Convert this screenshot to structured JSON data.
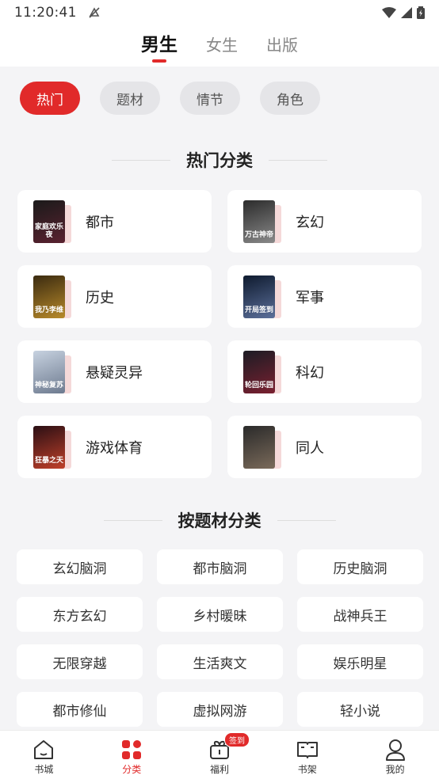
{
  "status_bar": {
    "time": "11:20:41"
  },
  "gender_tabs": [
    {
      "label": "男生",
      "active": true
    },
    {
      "label": "女生",
      "active": false
    },
    {
      "label": "出版",
      "active": false
    }
  ],
  "filter_chips": [
    {
      "label": "热门",
      "active": true
    },
    {
      "label": "题材",
      "active": false
    },
    {
      "label": "情节",
      "active": false
    },
    {
      "label": "角色",
      "active": false
    }
  ],
  "hot_section": {
    "title": "热门分类",
    "categories": [
      {
        "label": "都市",
        "cover_text": "家庭欢乐夜",
        "cover_colors": [
          "#1a1a1a",
          "#5a2230"
        ]
      },
      {
        "label": "玄幻",
        "cover_text": "万古神帝",
        "cover_colors": [
          "#2b2b2b",
          "#8a8a8a"
        ]
      },
      {
        "label": "历史",
        "cover_text": "我乃李维",
        "cover_colors": [
          "#3a2a10",
          "#b88a2a"
        ]
      },
      {
        "label": "军事",
        "cover_text": "开局签到",
        "cover_colors": [
          "#0e1a2e",
          "#5b6f9a"
        ]
      },
      {
        "label": "悬疑灵异",
        "cover_text": "神秘复苏",
        "cover_colors": [
          "#c7d2e0",
          "#6d7a8f"
        ]
      },
      {
        "label": "科幻",
        "cover_text": "轮回乐园",
        "cover_colors": [
          "#1c1c24",
          "#7a2030"
        ]
      },
      {
        "label": "游戏体育",
        "cover_text": "狂暴之天",
        "cover_colors": [
          "#2a0f14",
          "#c0402a"
        ]
      },
      {
        "label": "同人",
        "cover_text": "",
        "cover_colors": [
          "#2a2a2a",
          "#7a6a5a"
        ]
      }
    ]
  },
  "theme_section": {
    "title": "按题材分类",
    "tags": [
      "玄幻脑洞",
      "都市脑洞",
      "历史脑洞",
      "东方玄幻",
      "乡村暖昧",
      "战神兵王",
      "无限穿越",
      "生活爽文",
      "娱乐明星",
      "都市修仙",
      "虚拟网游",
      "轻小说"
    ]
  },
  "bottom_nav": [
    {
      "label": "书城",
      "icon": "home-icon",
      "active": false
    },
    {
      "label": "分类",
      "icon": "category-icon",
      "active": true
    },
    {
      "label": "福利",
      "icon": "gift-icon",
      "active": false,
      "badge": "签到"
    },
    {
      "label": "书架",
      "icon": "bookshelf-icon",
      "active": false
    },
    {
      "label": "我的",
      "icon": "profile-icon",
      "active": false
    }
  ],
  "colors": {
    "accent": "#e12a2a",
    "background": "#f4f4f6"
  }
}
